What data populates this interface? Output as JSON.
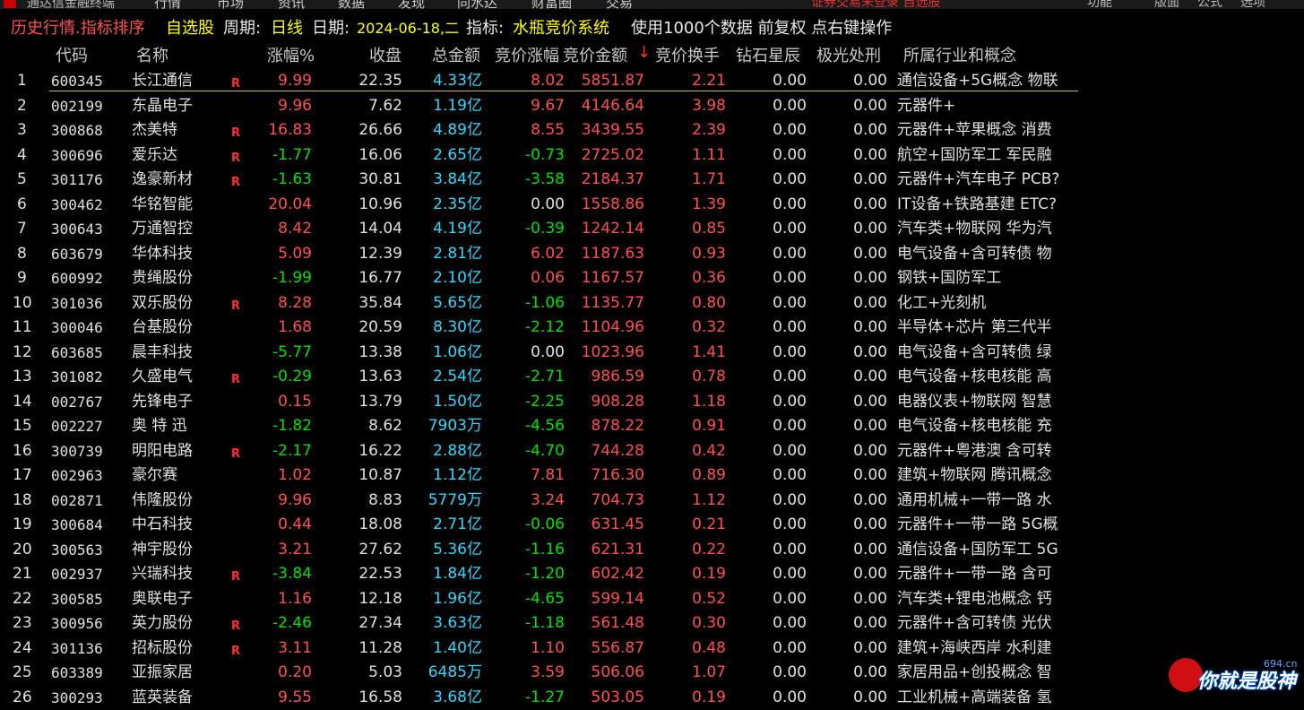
{
  "menubar": {
    "app_title": "通达信金融终端",
    "items": [
      "行情",
      "市场",
      "资讯",
      "数据",
      "发现",
      "同水达",
      "财富圈",
      "交易"
    ],
    "status": "证券交易未登录 自选股",
    "right_items": [
      "功能",
      "版面",
      "公式",
      "选项"
    ]
  },
  "infobar": {
    "mode": "历史行情.指标排序",
    "list": "自选股",
    "period_label": "周期:",
    "period": "日线",
    "date_label": "日期:",
    "date": "2024-06-18,二",
    "indicator_label": "指标:",
    "indicator": "水瓶竞价系统",
    "info": "使用1000个数据 前复权 点右键操作"
  },
  "columns": {
    "code": "代码",
    "name": "名称",
    "change": "涨幅%",
    "close": "收盘",
    "amount": "总金额",
    "bid_change": "竞价涨幅",
    "bid_amount": "竞价金额",
    "sort_arrow": "↓",
    "bid_turnover": "竞价换手",
    "star": "钻石星辰",
    "aurora": "极光处刑",
    "industry": "所属行业和概念"
  },
  "rows": [
    {
      "i": "1",
      "code": "600345",
      "name": "长江通信",
      "r": "R",
      "chg": "9.99",
      "close": "22.35",
      "amt": "4.33亿",
      "bchg": "8.02",
      "bamt": "5851.87",
      "bto": "2.21",
      "star": "0.00",
      "aur": "0.00",
      "ind": "通信设备+5G概念 物联"
    },
    {
      "i": "2",
      "code": "002199",
      "name": "东晶电子",
      "r": "",
      "chg": "9.96",
      "close": "7.62",
      "amt": "1.19亿",
      "bchg": "9.67",
      "bamt": "4146.64",
      "bto": "3.98",
      "star": "0.00",
      "aur": "0.00",
      "ind": "元器件+"
    },
    {
      "i": "3",
      "code": "300868",
      "name": "杰美特",
      "r": "R",
      "chg": "16.83",
      "close": "26.66",
      "amt": "4.89亿",
      "bchg": "8.55",
      "bamt": "3439.55",
      "bto": "2.39",
      "star": "0.00",
      "aur": "0.00",
      "ind": "元器件+苹果概念 消费"
    },
    {
      "i": "4",
      "code": "300696",
      "name": "爱乐达",
      "r": "R",
      "chg": "-1.77",
      "close": "16.06",
      "amt": "2.65亿",
      "bchg": "-0.73",
      "bamt": "2725.02",
      "bto": "1.11",
      "star": "0.00",
      "aur": "0.00",
      "ind": "航空+国防军工 军民融"
    },
    {
      "i": "5",
      "code": "301176",
      "name": "逸豪新材",
      "r": "R",
      "chg": "-1.63",
      "close": "30.81",
      "amt": "3.84亿",
      "bchg": "-3.58",
      "bamt": "2184.37",
      "bto": "1.71",
      "star": "0.00",
      "aur": "0.00",
      "ind": "元器件+汽车电子 PCB?"
    },
    {
      "i": "6",
      "code": "300462",
      "name": "华铭智能",
      "r": "",
      "chg": "20.04",
      "close": "10.96",
      "amt": "2.35亿",
      "bchg": "0.00",
      "bamt": "1558.86",
      "bto": "1.39",
      "star": "0.00",
      "aur": "0.00",
      "ind": "IT设备+铁路基建 ETC?"
    },
    {
      "i": "7",
      "code": "300643",
      "name": "万通智控",
      "r": "",
      "chg": "8.42",
      "close": "14.04",
      "amt": "4.19亿",
      "bchg": "-0.39",
      "bamt": "1242.14",
      "bto": "0.85",
      "star": "0.00",
      "aur": "0.00",
      "ind": "汽车类+物联网 华为汽"
    },
    {
      "i": "8",
      "code": "603679",
      "name": "华体科技",
      "r": "",
      "chg": "5.09",
      "close": "12.39",
      "amt": "2.81亿",
      "bchg": "6.02",
      "bamt": "1187.63",
      "bto": "0.93",
      "star": "0.00",
      "aur": "0.00",
      "ind": "电气设备+含可转债 物"
    },
    {
      "i": "9",
      "code": "600992",
      "name": "贵绳股份",
      "r": "",
      "chg": "-1.99",
      "close": "16.77",
      "amt": "2.10亿",
      "bchg": "0.06",
      "bamt": "1167.57",
      "bto": "0.36",
      "star": "0.00",
      "aur": "0.00",
      "ind": "钢铁+国防军工"
    },
    {
      "i": "10",
      "code": "301036",
      "name": "双乐股份",
      "r": "R",
      "chg": "8.28",
      "close": "35.84",
      "amt": "5.65亿",
      "bchg": "-1.06",
      "bamt": "1135.77",
      "bto": "0.80",
      "star": "0.00",
      "aur": "0.00",
      "ind": "化工+光刻机"
    },
    {
      "i": "11",
      "code": "300046",
      "name": "台基股份",
      "r": "",
      "chg": "1.68",
      "close": "20.59",
      "amt": "8.30亿",
      "bchg": "-2.12",
      "bamt": "1104.96",
      "bto": "0.32",
      "star": "0.00",
      "aur": "0.00",
      "ind": "半导体+芯片 第三代半"
    },
    {
      "i": "12",
      "code": "603685",
      "name": "晨丰科技",
      "r": "",
      "chg": "-5.77",
      "close": "13.38",
      "amt": "1.06亿",
      "bchg": "0.00",
      "bamt": "1023.96",
      "bto": "1.41",
      "star": "0.00",
      "aur": "0.00",
      "ind": "电气设备+含可转债 绿"
    },
    {
      "i": "13",
      "code": "301082",
      "name": "久盛电气",
      "r": "R",
      "chg": "-0.29",
      "close": "13.63",
      "amt": "2.54亿",
      "bchg": "-2.71",
      "bamt": "986.59",
      "bto": "0.78",
      "star": "0.00",
      "aur": "0.00",
      "ind": "电气设备+核电核能 高"
    },
    {
      "i": "14",
      "code": "002767",
      "name": "先锋电子",
      "r": "",
      "chg": "0.15",
      "close": "13.79",
      "amt": "1.50亿",
      "bchg": "-2.25",
      "bamt": "908.28",
      "bto": "1.18",
      "star": "0.00",
      "aur": "0.00",
      "ind": "电器仪表+物联网 智慧"
    },
    {
      "i": "15",
      "code": "002227",
      "name": "奥 特 迅",
      "r": "",
      "chg": "-1.82",
      "close": "8.62",
      "amt": "7903万",
      "bchg": "-4.56",
      "bamt": "878.22",
      "bto": "0.91",
      "star": "0.00",
      "aur": "0.00",
      "ind": "电气设备+核电核能 充"
    },
    {
      "i": "16",
      "code": "300739",
      "name": "明阳电路",
      "r": "R",
      "chg": "-2.17",
      "close": "16.22",
      "amt": "2.88亿",
      "bchg": "-4.70",
      "bamt": "744.28",
      "bto": "0.42",
      "star": "0.00",
      "aur": "0.00",
      "ind": "元器件+粤港澳 含可转"
    },
    {
      "i": "17",
      "code": "002963",
      "name": "豪尔赛",
      "r": "",
      "chg": "1.02",
      "close": "10.87",
      "amt": "1.12亿",
      "bchg": "7.81",
      "bamt": "716.30",
      "bto": "0.89",
      "star": "0.00",
      "aur": "0.00",
      "ind": "建筑+物联网 腾讯概念"
    },
    {
      "i": "18",
      "code": "002871",
      "name": "伟隆股份",
      "r": "",
      "chg": "9.96",
      "close": "8.83",
      "amt": "5779万",
      "bchg": "3.24",
      "bamt": "704.73",
      "bto": "1.12",
      "star": "0.00",
      "aur": "0.00",
      "ind": "通用机械+一带一路 水"
    },
    {
      "i": "19",
      "code": "300684",
      "name": "中石科技",
      "r": "",
      "chg": "0.44",
      "close": "18.08",
      "amt": "2.71亿",
      "bchg": "-0.06",
      "bamt": "631.45",
      "bto": "0.21",
      "star": "0.00",
      "aur": "0.00",
      "ind": "元器件+一带一路 5G概"
    },
    {
      "i": "20",
      "code": "300563",
      "name": "神宇股份",
      "r": "",
      "chg": "3.21",
      "close": "27.62",
      "amt": "5.36亿",
      "bchg": "-1.16",
      "bamt": "621.31",
      "bto": "0.22",
      "star": "0.00",
      "aur": "0.00",
      "ind": "通信设备+国防军工 5G"
    },
    {
      "i": "21",
      "code": "002937",
      "name": "兴瑞科技",
      "r": "R",
      "chg": "-3.84",
      "close": "22.53",
      "amt": "1.84亿",
      "bchg": "-1.20",
      "bamt": "602.42",
      "bto": "0.19",
      "star": "0.00",
      "aur": "0.00",
      "ind": "元器件+一带一路 含可"
    },
    {
      "i": "22",
      "code": "300585",
      "name": "奥联电子",
      "r": "",
      "chg": "1.16",
      "close": "12.18",
      "amt": "1.96亿",
      "bchg": "-4.65",
      "bamt": "599.14",
      "bto": "0.52",
      "star": "0.00",
      "aur": "0.00",
      "ind": "汽车类+锂电池概念 钙"
    },
    {
      "i": "23",
      "code": "300956",
      "name": "英力股份",
      "r": "R",
      "chg": "-2.46",
      "close": "27.34",
      "amt": "3.63亿",
      "bchg": "-1.18",
      "bamt": "561.48",
      "bto": "0.30",
      "star": "0.00",
      "aur": "0.00",
      "ind": "元器件+含可转债 光伏"
    },
    {
      "i": "24",
      "code": "301136",
      "name": "招标股份",
      "r": "R",
      "chg": "3.11",
      "close": "11.28",
      "amt": "1.40亿",
      "bchg": "1.10",
      "bamt": "556.87",
      "bto": "0.48",
      "star": "0.00",
      "aur": "0.00",
      "ind": "建筑+海峡西岸 水利建"
    },
    {
      "i": "25",
      "code": "603389",
      "name": "亚振家居",
      "r": "",
      "chg": "0.20",
      "close": "5.03",
      "amt": "6485万",
      "bchg": "3.59",
      "bamt": "506.06",
      "bto": "1.07",
      "star": "0.00",
      "aur": "0.00",
      "ind": "家居用品+创投概念 智"
    },
    {
      "i": "26",
      "code": "300293",
      "name": "蓝英装备",
      "r": "",
      "chg": "9.55",
      "close": "16.58",
      "amt": "3.68亿",
      "bchg": "-1.27",
      "bamt": "503.05",
      "bto": "0.19",
      "star": "0.00",
      "aur": "0.00",
      "ind": "工业机械+高端装备 氢"
    }
  ],
  "watermark": {
    "text": "你就是股神",
    "site": "694.cn"
  },
  "colors": {
    "up": "#ff5050",
    "down": "#00e000",
    "neutral": "#e0e0e0",
    "amount": "#30d8ff",
    "bid_amount": "#ff5050",
    "bid_turnover": "#ff5050"
  }
}
